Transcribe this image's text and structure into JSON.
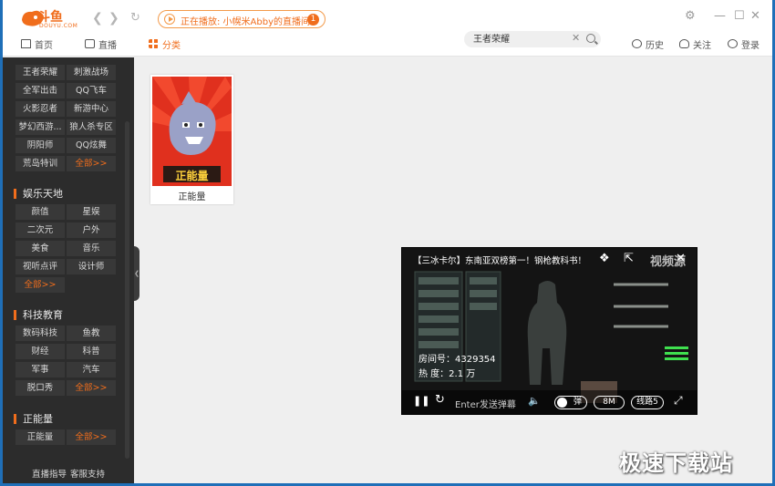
{
  "app": {
    "logo_text": "斗鱼",
    "logo_sub": "DOUYU.COM"
  },
  "live_notice": {
    "text": "正在播放: 小幌米Abby的直播间",
    "badge": "1"
  },
  "menu": {
    "home": "首页",
    "live": "直播",
    "category": "分类",
    "history": "历史",
    "follow": "关注",
    "login": "登录"
  },
  "search": {
    "value": "王者荣耀"
  },
  "sidebar": {
    "games": [
      "王者荣耀",
      "刺激战场",
      "全军出击",
      "QQ飞车",
      "火影忍者",
      "新游中心",
      "梦幻西游...",
      "狼人杀专区",
      "阴阳师",
      "QQ炫舞",
      "荒岛特训"
    ],
    "more": "全部>>",
    "sections": [
      {
        "title": "娱乐天地",
        "items": [
          "颜值",
          "星娱",
          "二次元",
          "户外",
          "美食",
          "音乐",
          "视听点评",
          "设计师"
        ]
      },
      {
        "title": "科技教育",
        "items": [
          "数码科技",
          "鱼教",
          "财经",
          "科普",
          "军事",
          "汽车",
          "脱口秀"
        ]
      },
      {
        "title": "正能量",
        "items": [
          "正能量"
        ]
      }
    ],
    "footer": [
      "直播指导",
      "客服支持"
    ]
  },
  "card": {
    "label": "正能量",
    "thumb_text": "正能量"
  },
  "video": {
    "title": "【三冰卡尔】东南亚双榜第一！钢枪教科书！",
    "room": "房间号：4329354",
    "heat": "热    度：2.1 万",
    "danmu_placeholder": "Enter发送弹幕",
    "danmu_toggle": "弹",
    "quality": "8M",
    "line": "线路5",
    "overlay_text": "视频源"
  },
  "watermark": "极速下载站",
  "colors": {
    "accent": "#f06d1c",
    "sidebar": "#2c2c2c"
  }
}
